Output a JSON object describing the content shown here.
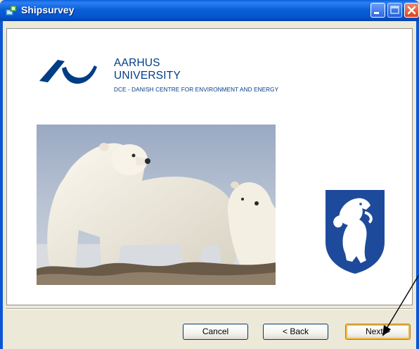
{
  "window": {
    "title": "Shipsurvey"
  },
  "header": {
    "university_line1": "AARHUS",
    "university_line2": "UNIVERSITY",
    "department": "DCE - DANISH CENTRE FOR ENVIRONMENT AND ENERGY"
  },
  "buttons": {
    "cancel": "Cancel",
    "back": "< Back",
    "next": "Next >"
  },
  "colors": {
    "titlebar": "#0a5fd8",
    "logo_blue": "#003d85",
    "coat_blue": "#1e4a9b"
  },
  "icons": {
    "app": "setup-icon",
    "minimize": "minimize-icon",
    "maximize": "maximize-icon",
    "close": "close-icon"
  }
}
